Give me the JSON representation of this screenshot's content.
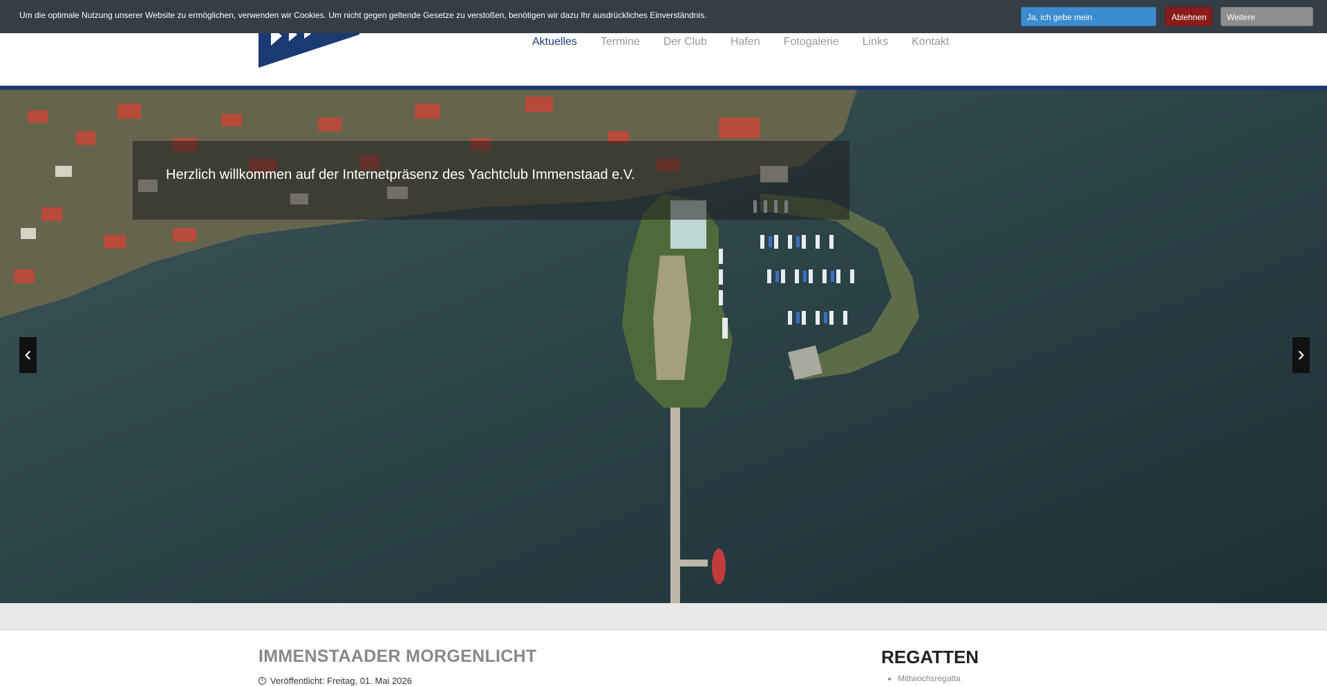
{
  "cookie": {
    "text": "Um die optimale Nutzung unserer Website zu ermöglichen, verwenden wir Cookies. Um nicht gegen geltende Gesetze zu verstoßen, benötigen wir dazu Ihr ausdrückliches Einverständnis.",
    "accept_label": "Ja, ich gebe mein Einverständnis!",
    "decline_label": "Ablehnen",
    "more_label": "Weitere Informationen"
  },
  "nav": {
    "items": [
      {
        "label": "Aktuelles",
        "active": true
      },
      {
        "label": "Termine"
      },
      {
        "label": "Der Club"
      },
      {
        "label": "Hafen"
      },
      {
        "label": "Fotogalerie"
      },
      {
        "label": "Links"
      },
      {
        "label": "Kontakt"
      }
    ]
  },
  "hero": {
    "caption": "Herzlich willkommen auf der Internetpräsenz des Yachtclub Immenstaad e.V.",
    "prev_icon": "chevron-left-icon",
    "next_icon": "chevron-right-icon"
  },
  "article": {
    "title": "IMMENSTAADER MORGENLICHT",
    "published": "Veröffentlicht: Freitag, 01. Mai 2026"
  },
  "sidebar": {
    "title": "REGATTEN",
    "items": [
      "Mittwochsregatta"
    ]
  },
  "colors": {
    "brand": "#1b3a73",
    "cookie_bar": "#353d47",
    "accept": "#3c8dd0",
    "decline": "#8a1c1c",
    "more": "#8e8e8e"
  }
}
